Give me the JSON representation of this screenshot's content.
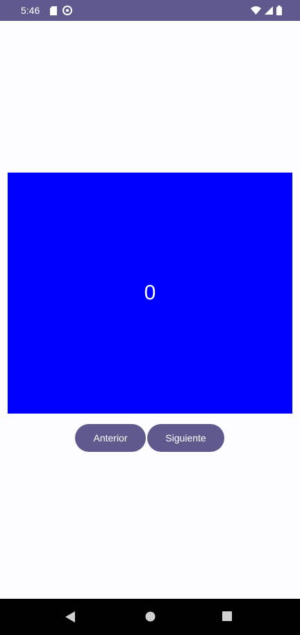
{
  "status_bar": {
    "time": "5:46",
    "left_icons": [
      "sd-card-icon",
      "accessibility-icon"
    ],
    "right_icons": [
      "wifi-icon",
      "signal-icon",
      "battery-icon"
    ],
    "background": "#5e5a8d"
  },
  "main": {
    "panel_color": "#0000ff",
    "counter": "0"
  },
  "buttons": {
    "previous_label": "Anterior",
    "next_label": "Siguiente",
    "color": "#5e5a8d"
  },
  "nav_bar": {
    "items": [
      "back-icon",
      "home-icon",
      "recents-icon"
    ]
  }
}
